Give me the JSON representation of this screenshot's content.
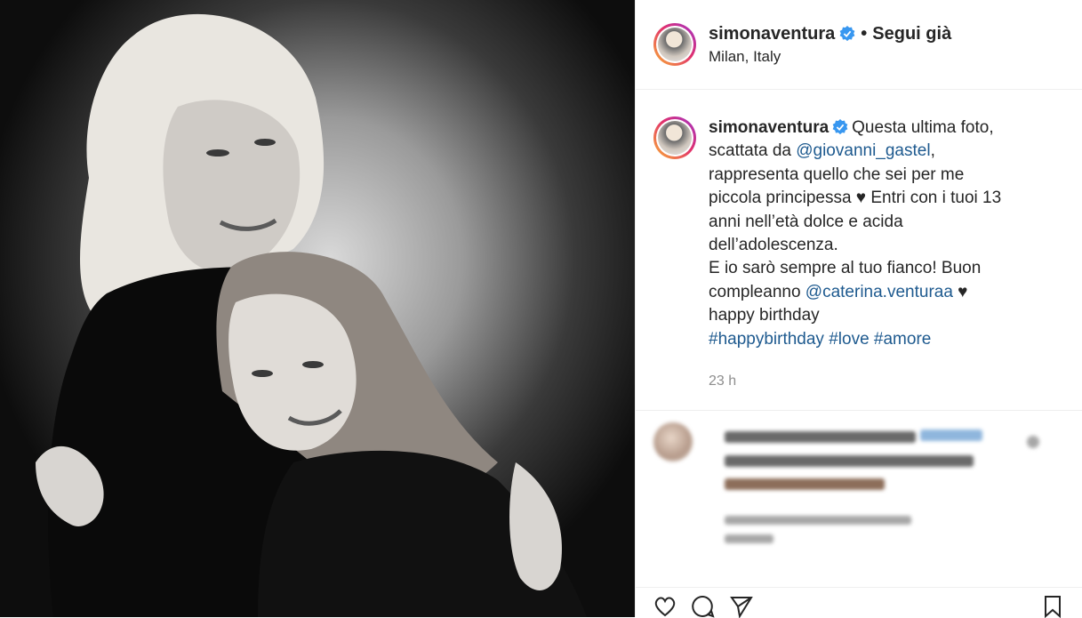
{
  "post": {
    "username": "simonaventura",
    "follow_sep": "•",
    "follow_label": "Segui già",
    "location": "Milan, Italy",
    "caption_parts": {
      "p1": "Questa ultima foto, scattata da ",
      "mention1": "@giovanni_gastel",
      "p2": ", rappresenta quello che sei per me piccola principessa ♥ Entri con i tuoi 13 anni nell’età dolce e acida dell’adolescenza.",
      "p3": "E io sarò sempre al tuo fianco! Buon compleanno ",
      "mention2": "@caterina.venturaa",
      "p4": " ♥",
      "p5": "happy birthday",
      "tag1": "#happybirthday",
      "tag2": "#love",
      "tag3": "#amore"
    },
    "time": "23 h"
  },
  "icons": {
    "verified": "verified-badge-icon",
    "like": "heart-icon",
    "comment": "comment-icon",
    "share": "share-icon",
    "save": "bookmark-icon"
  },
  "colors": {
    "link": "#1e5a8f",
    "verified": "#3897f0",
    "muted": "#8e8e8e"
  }
}
